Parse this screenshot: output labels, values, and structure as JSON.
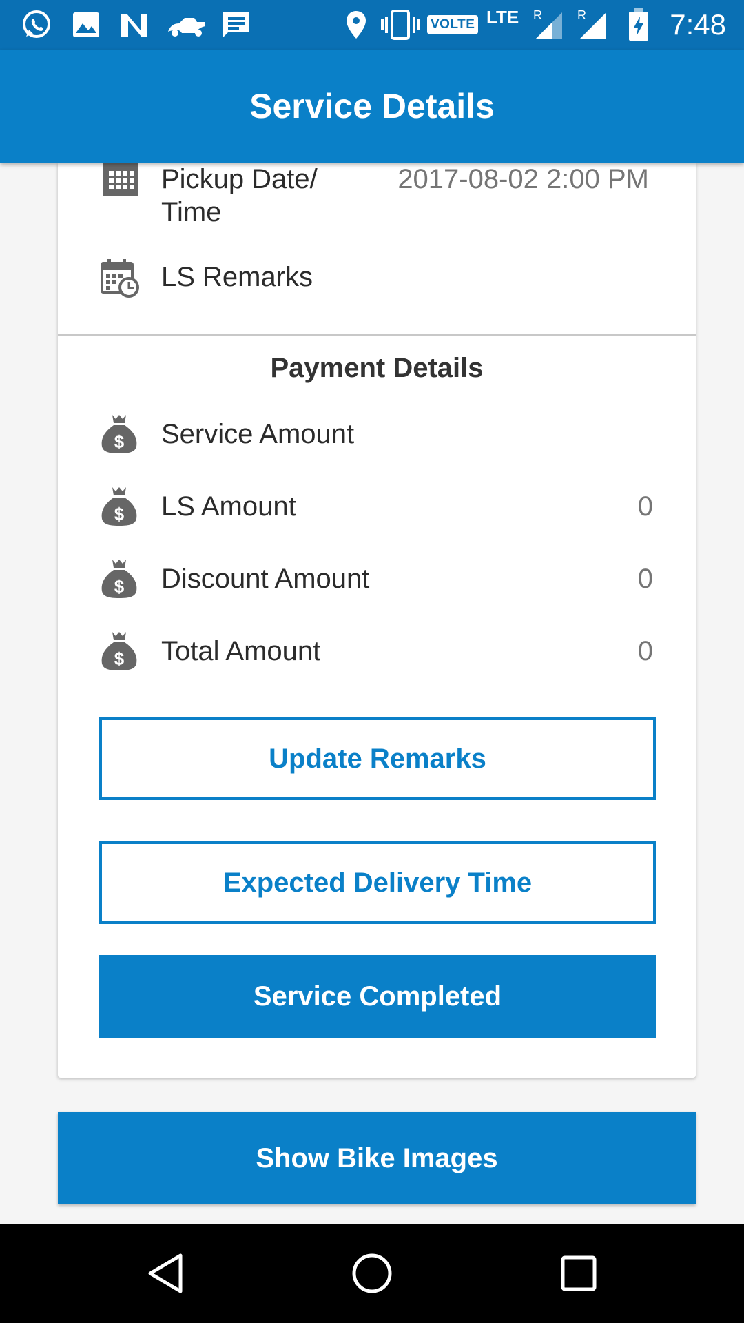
{
  "status_bar": {
    "time": "7:48",
    "volte": "VOLTE",
    "lte": "LTE",
    "roaming_1": "R",
    "roaming_2": "R",
    "icons": [
      "whatsapp-icon",
      "gallery-icon",
      "n-app-icon",
      "bike-app-icon",
      "message-icon",
      "location-icon",
      "vibrate-icon",
      "volte-icon",
      "signal-icon",
      "signal-icon",
      "battery-charging-icon"
    ]
  },
  "app_bar": {
    "title": "Service Details"
  },
  "details": {
    "pickup_label": "Pickup Date/\nTime",
    "pickup_label_line1": "Pickup Date/",
    "pickup_label_line2": "Time",
    "pickup_value": "2017-08-02 2:00 PM",
    "ls_remarks_label": "LS Remarks",
    "ls_remarks_value": ""
  },
  "payment": {
    "title": "Payment Details",
    "rows": [
      {
        "label": "Service Amount",
        "value": ""
      },
      {
        "label": "LS Amount",
        "value": "0"
      },
      {
        "label": "Discount Amount",
        "value": "0"
      },
      {
        "label": "Total Amount",
        "value": "0"
      }
    ]
  },
  "buttons": {
    "update_remarks": "Update Remarks",
    "expected_delivery": "Expected Delivery Time",
    "service_completed": "Service Completed",
    "show_bike_images": "Show Bike Images"
  },
  "colors": {
    "status_bar": "#0a70b4",
    "primary": "#0a80c8",
    "icon_gray": "#666666"
  }
}
